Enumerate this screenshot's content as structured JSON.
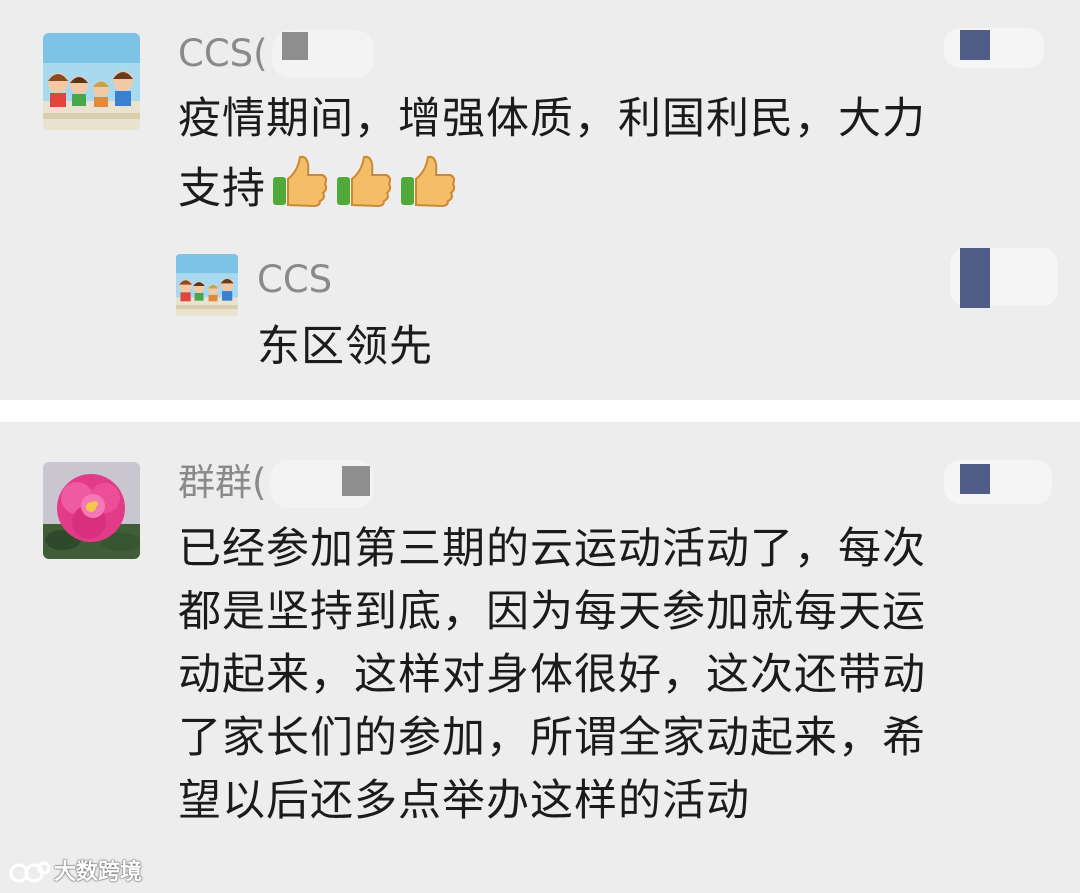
{
  "comments": [
    {
      "avatar": "cartoon-family-avatar",
      "username": "CCS(",
      "lines": [
        "疫情期间，增强体质，利国利民，大力",
        "支持"
      ],
      "emoji": [
        "thumbs-up-icon",
        "thumbs-up-icon",
        "thumbs-up-icon"
      ],
      "reply": {
        "avatar": "cartoon-family-avatar",
        "username": "CCS",
        "text": "东区领先"
      }
    },
    {
      "avatar": "pink-flower-avatar",
      "username": "群群(",
      "lines": [
        "已经参加第三期的云运动活动了，每次",
        "都是坚持到底，因为每天参加就每天运",
        "动起来，这样对身体很好，这次还带动",
        "了家长们的参加，所谓全家动起来，希",
        "望以后还多点举办这样的活动"
      ]
    }
  ],
  "watermark": {
    "text": "大数跨境"
  }
}
